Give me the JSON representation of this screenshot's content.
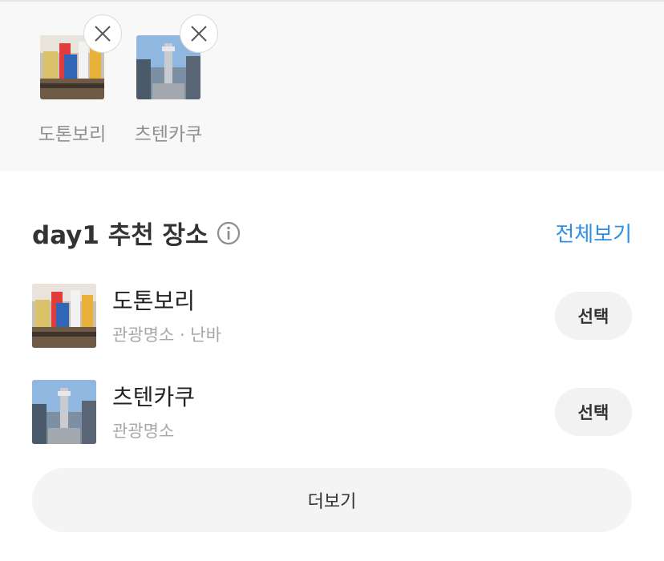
{
  "selected_places": [
    {
      "name": "도톤보리",
      "remove_icon": "close-icon"
    },
    {
      "name": "츠텐카쿠",
      "remove_icon": "close-icon"
    }
  ],
  "section": {
    "title": "day1 추천 장소",
    "info_icon": "info-icon",
    "view_all_label": "전체보기"
  },
  "places": [
    {
      "name": "도톤보리",
      "meta": "관광명소 · 난바",
      "button_label": "선택"
    },
    {
      "name": "츠텐카쿠",
      "meta": "관광명소",
      "button_label": "선택"
    }
  ],
  "more_label": "더보기",
  "colors": {
    "accent": "#2f8fe8",
    "muted_text": "#a7a7a7",
    "button_bg": "#f2f2f2"
  }
}
